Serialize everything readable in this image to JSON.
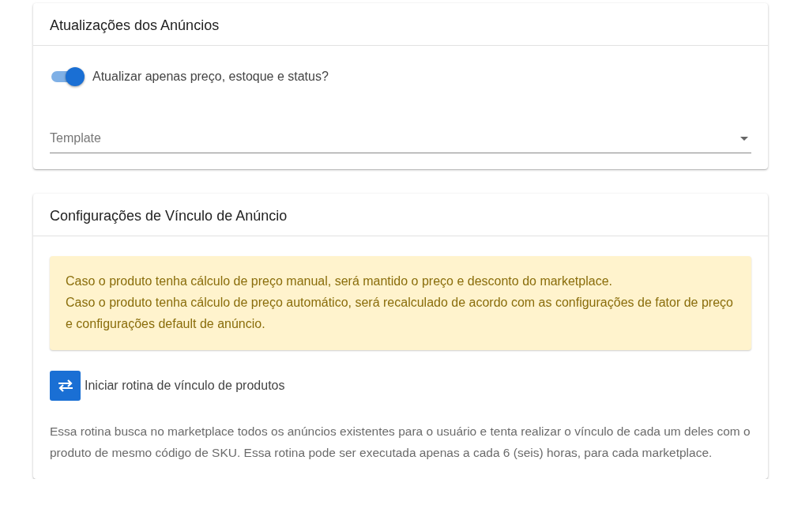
{
  "cards": [
    {
      "title": "Atualizações dos Anúncios",
      "toggle": {
        "label": "Atualizar apenas preço, estoque e status?",
        "on": true
      },
      "select": {
        "placeholder": "Template"
      }
    },
    {
      "title": "Configurações de Vínculo de Anúncio",
      "alert": [
        "Caso o produto tenha cálculo de preço manual, será mantido o preço e desconto do marketplace.",
        "Caso o produto tenha cálculo de preço automático, será recalculado de acordo com as configurações de fator de preço e configurações default de anúncio."
      ],
      "action": {
        "label": "Iniciar rotina de vínculo de produtos"
      },
      "description": "Essa rotina busca no marketplace todos os anúncios existentes para o usuário e tenta realizar o vínculo de cada um deles com o produto de mesmo código de SKU. Essa rotina pode ser executada apenas a cada 6 (seis) horas, para cada marketplace."
    }
  ]
}
